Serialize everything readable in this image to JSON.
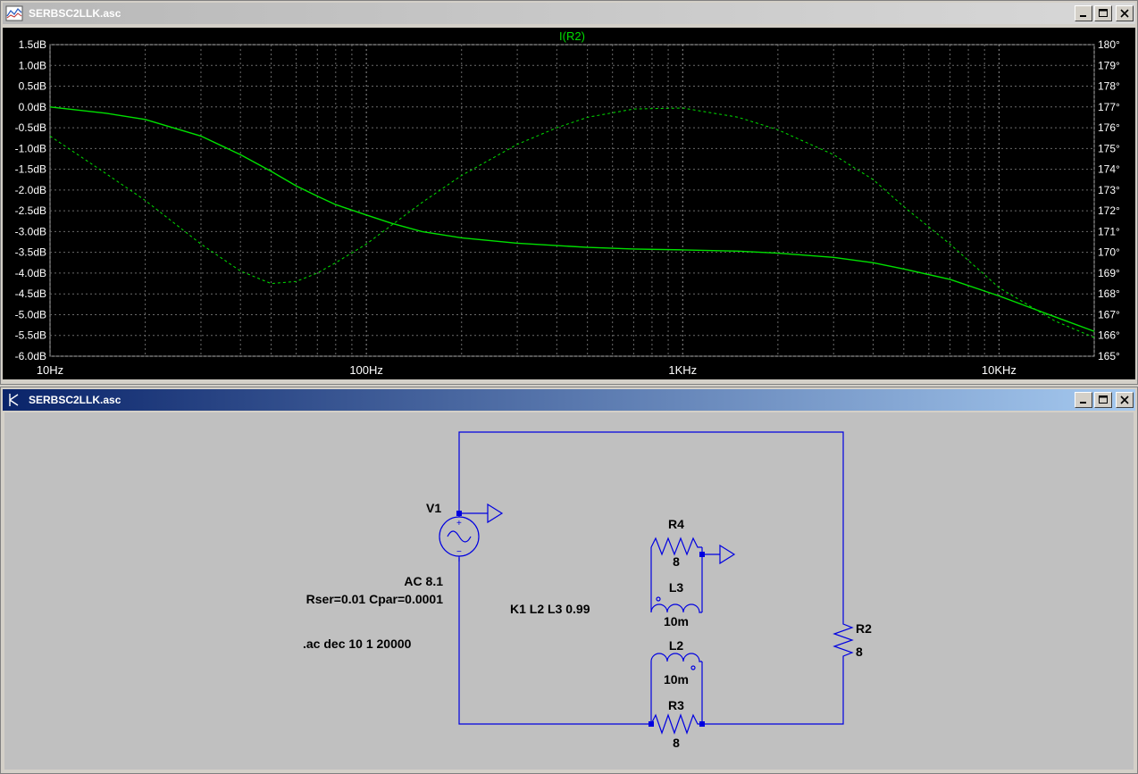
{
  "waveform_window": {
    "title": "SERBSC2LLK.asc",
    "plot_trace_label": "I(R2)"
  },
  "schematic_window": {
    "title": "SERBSC2LLK.asc",
    "labels": {
      "v1": "V1",
      "ac": "AC 8.1",
      "rser": "Rser=0.01 Cpar=0.0001",
      "ac_cmd": ".ac dec 10 1 20000",
      "k1": "K1 L2 L3 0.99",
      "r4": "R4",
      "r4_val": "8",
      "l3": "L3",
      "l3_val": "10m",
      "l2": "L2",
      "l2_val": "10m",
      "r3": "R3",
      "r3_val": "8",
      "r2": "R2",
      "r2_val": "8"
    }
  },
  "chart_data": {
    "type": "line",
    "title": "I(R2)",
    "x_scale": "log",
    "xlim": [
      10,
      20000
    ],
    "x_ticks": [
      10,
      100,
      1000,
      10000
    ],
    "x_tick_labels": [
      "10Hz",
      "100Hz",
      "1KHz",
      "10KHz"
    ],
    "ylim_left": [
      -6.0,
      1.5
    ],
    "y_ticks_left": [
      "1.5dB",
      "1.0dB",
      "0.5dB",
      "0.0dB",
      "-0.5dB",
      "-1.0dB",
      "-1.5dB",
      "-2.0dB",
      "-2.5dB",
      "-3.0dB",
      "-3.5dB",
      "-4.0dB",
      "-4.5dB",
      "-5.0dB",
      "-5.5dB",
      "-6.0dB"
    ],
    "ylim_right": [
      165,
      180
    ],
    "y_ticks_right": [
      "180°",
      "179°",
      "178°",
      "177°",
      "176°",
      "175°",
      "174°",
      "173°",
      "172°",
      "171°",
      "170°",
      "169°",
      "168°",
      "167°",
      "166°",
      "165°"
    ],
    "grid": true,
    "series": [
      {
        "style": "solid",
        "axis": "left",
        "color": "#00e000",
        "x": [
          10,
          15,
          20,
          30,
          40,
          50,
          60,
          70,
          80,
          100,
          120,
          150,
          200,
          300,
          500,
          700,
          1000,
          1500,
          2000,
          3000,
          4000,
          5000,
          7000,
          10000,
          15000,
          20000
        ],
        "y": [
          0.0,
          -0.15,
          -0.3,
          -0.7,
          -1.15,
          -1.55,
          -1.9,
          -2.15,
          -2.35,
          -2.6,
          -2.8,
          -3.0,
          -3.15,
          -3.28,
          -3.38,
          -3.42,
          -3.44,
          -3.47,
          -3.52,
          -3.62,
          -3.75,
          -3.9,
          -4.15,
          -4.55,
          -5.05,
          -5.4
        ]
      },
      {
        "style": "dashed",
        "axis": "right",
        "color": "#00e000",
        "x": [
          10,
          15,
          20,
          30,
          40,
          50,
          60,
          70,
          80,
          100,
          120,
          150,
          200,
          300,
          400,
          500,
          700,
          1000,
          1500,
          2000,
          3000,
          4000,
          5000,
          7000,
          10000,
          15000,
          20000
        ],
        "y": [
          175.6,
          173.8,
          172.5,
          170.4,
          169.1,
          168.5,
          168.6,
          169.0,
          169.5,
          170.4,
          171.3,
          172.4,
          173.7,
          175.2,
          176.0,
          176.5,
          176.9,
          176.95,
          176.5,
          175.9,
          174.7,
          173.5,
          172.2,
          170.4,
          168.3,
          166.7,
          165.9
        ]
      }
    ]
  }
}
